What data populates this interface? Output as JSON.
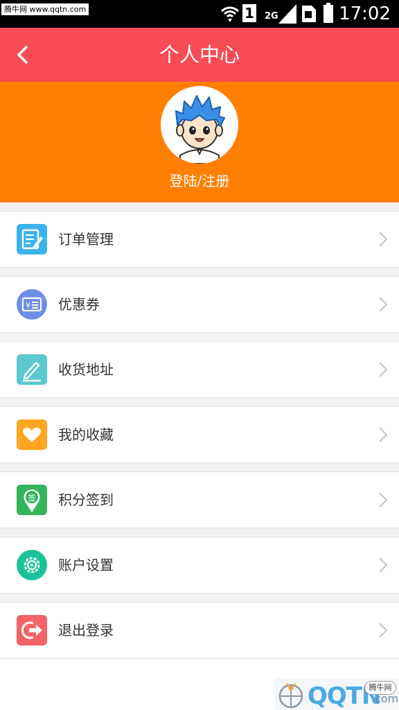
{
  "status_bar": {
    "watermark_text": "腾牛网 www.qqtn.com",
    "sim_slot": "1",
    "network": "2G",
    "time": "17:02"
  },
  "header": {
    "title": "个人中心",
    "back_icon": "chevron-left-icon"
  },
  "profile": {
    "login_text": "登陆/注册",
    "avatar_icon": "cartoon-avatar"
  },
  "menu": {
    "items": [
      {
        "label": "订单管理",
        "icon": "order-list-icon",
        "color": "#3bb3ea"
      },
      {
        "label": "优惠券",
        "icon": "coupon-icon",
        "color": "#6e8ee6"
      },
      {
        "label": "收货地址",
        "icon": "edit-pencil-icon",
        "color": "#5cc8d0"
      },
      {
        "label": "我的收藏",
        "icon": "heart-icon",
        "color": "#ffa51f"
      },
      {
        "label": "积分签到",
        "icon": "checkin-pin-icon",
        "color": "#36b45c"
      },
      {
        "label": "账户设置",
        "icon": "settings-gear-icon",
        "color": "#19c39a"
      },
      {
        "label": "退出登录",
        "icon": "logout-icon",
        "color": "#f36368"
      }
    ]
  },
  "watermark": {
    "logo_text": "QQTN",
    "suffix": ".com",
    "badge": "腾牛网"
  }
}
